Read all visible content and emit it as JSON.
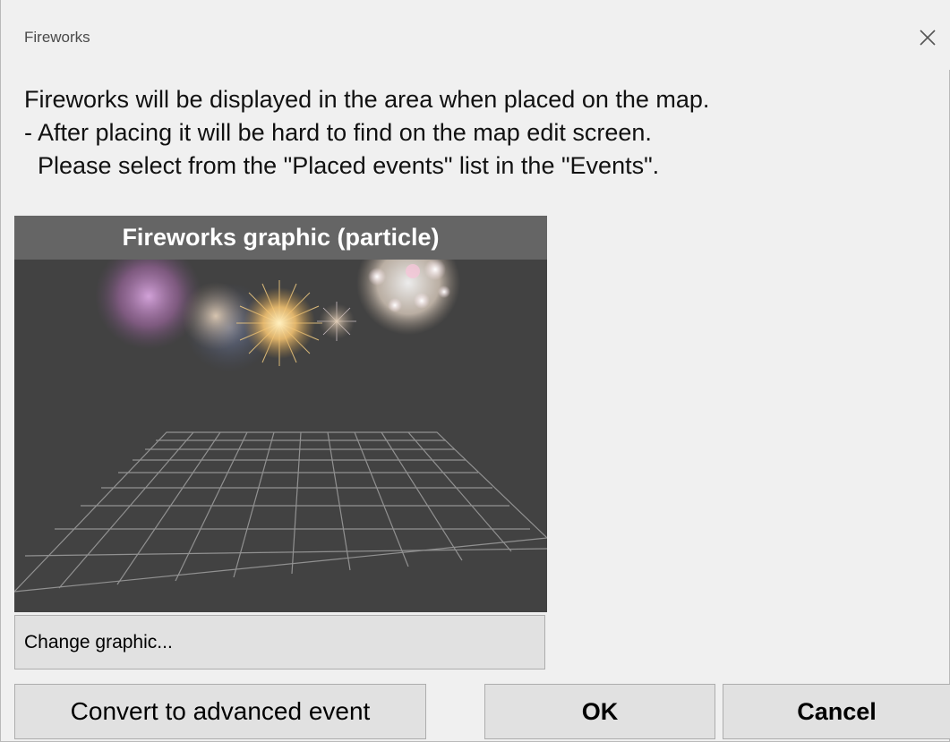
{
  "window": {
    "title": "Fireworks",
    "close_icon": "close-icon"
  },
  "message": {
    "line1": "Fireworks will be displayed in the area when placed on the map.",
    "line2": "- After placing it will be hard to find on the map edit screen.",
    "line3": "  Please select from the \"Placed events\" list in the \"Events\"."
  },
  "preview": {
    "header": "Fireworks graphic (particle)",
    "background_color": "#424242",
    "header_color": "#656565"
  },
  "buttons": {
    "change_graphic": "Change graphic...",
    "convert": "Convert to advanced event",
    "ok": "OK",
    "cancel": "Cancel"
  },
  "colors": {
    "accent": "#c2445a",
    "dialog_bg": "#f0f0f0",
    "button_bg": "#e1e1e1"
  }
}
